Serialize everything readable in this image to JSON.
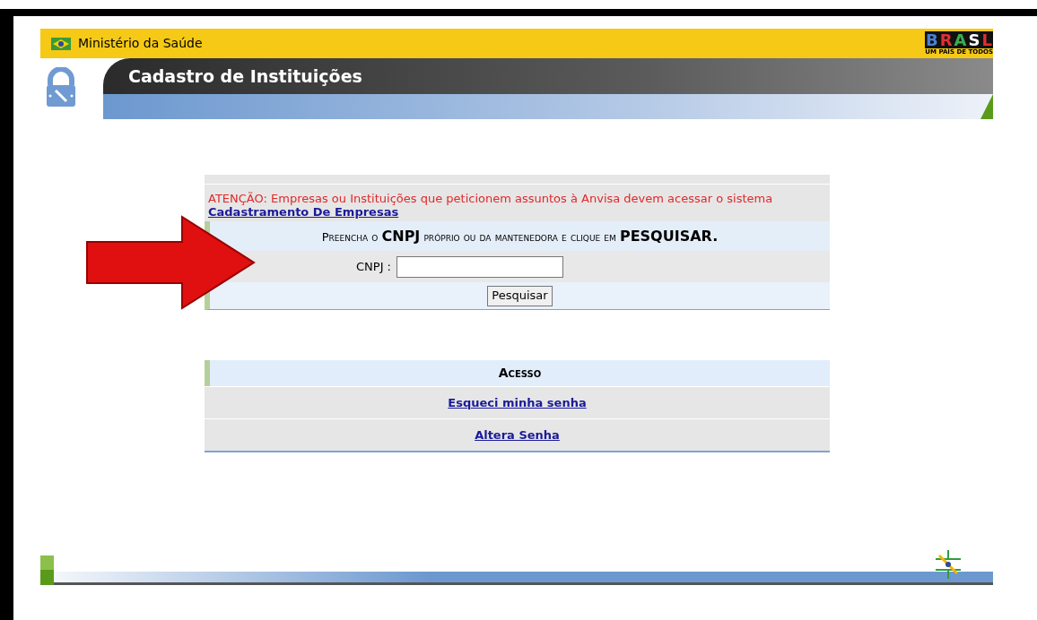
{
  "header": {
    "ministry": "Ministério da Saúde",
    "title": "Cadastro de Instituições",
    "brand_letters": [
      "B",
      "R",
      "A",
      "S",
      "L"
    ],
    "brand_tagline": "UM PAÍS DE TODOS"
  },
  "form": {
    "notice": "ATENÇÃO: Empresas ou Instituições que peticionem assuntos à Anvisa devem acessar o sistema",
    "notice_link": "Cadastramento De Empresas",
    "instruction": "Preencha o **CNPJ** próprio ou da mantenedora e clique em **PESQUISAR.**",
    "field_label": "CNPJ :",
    "button": "Pesquisar"
  },
  "access": {
    "heading": "Acesso",
    "links": [
      "Esqueci minha senha",
      "Altera Senha"
    ]
  }
}
